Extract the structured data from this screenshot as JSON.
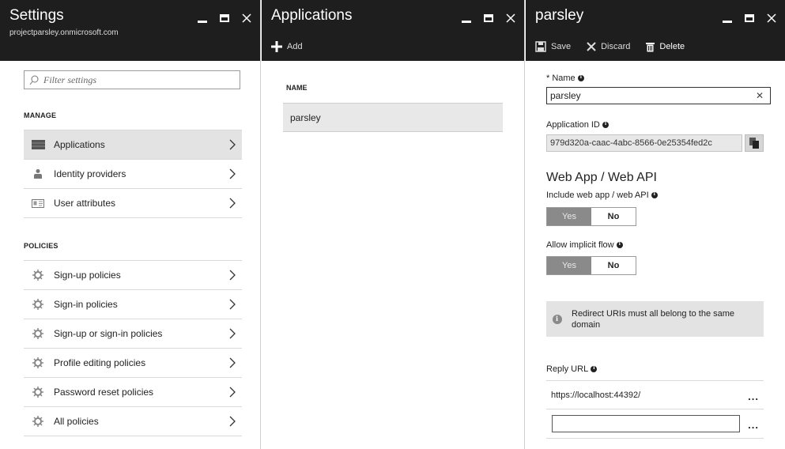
{
  "settings": {
    "title": "Settings",
    "subtitle": "projectparsley.onmicrosoft.com",
    "filter_placeholder": "Filter settings",
    "manage_heading": "MANAGE",
    "manage_items": [
      {
        "label": "Applications",
        "icon": "grid-icon"
      },
      {
        "label": "Identity providers",
        "icon": "people-icon"
      },
      {
        "label": "User attributes",
        "icon": "id-card-icon"
      }
    ],
    "policies_heading": "POLICIES",
    "policy_items": [
      {
        "label": "Sign-up policies",
        "icon": "gear-icon"
      },
      {
        "label": "Sign-in policies",
        "icon": "gear-icon"
      },
      {
        "label": "Sign-up or sign-in policies",
        "icon": "gear-icon"
      },
      {
        "label": "Profile editing policies",
        "icon": "gear-icon"
      },
      {
        "label": "Password reset policies",
        "icon": "gear-icon"
      },
      {
        "label": "All policies",
        "icon": "gear-icon"
      }
    ]
  },
  "applications": {
    "title": "Applications",
    "add_label": "Add",
    "column_name": "NAME",
    "rows": [
      "parsley"
    ]
  },
  "parsley": {
    "title": "parsley",
    "save_label": "Save",
    "discard_label": "Discard",
    "delete_label": "Delete",
    "name_label": "* Name",
    "name_value": "parsley",
    "appid_label": "Application ID",
    "appid_value": "979d320a-caac-4abc-8566-0e25354fed2c",
    "webapp_title": "Web App / Web API",
    "include_label": "Include web app / web API",
    "include_yes": "Yes",
    "include_no": "No",
    "implicit_label": "Allow implicit flow",
    "implicit_yes": "Yes",
    "implicit_no": "No",
    "notice": "Redirect URIs must all belong to the same domain",
    "reply_url_label": "Reply URL",
    "reply_urls": [
      "https://localhost:44392/"
    ],
    "more_label": "..."
  }
}
